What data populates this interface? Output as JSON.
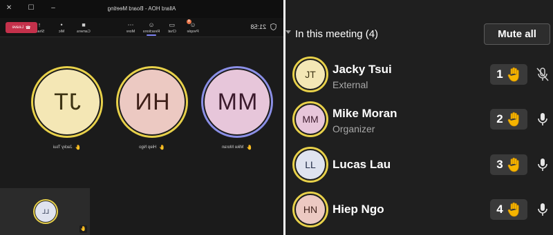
{
  "window": {
    "title": "Allard HOA - Board Meeting",
    "controls": [
      "✕",
      "☐",
      "–"
    ]
  },
  "toolbar": {
    "timer": "21:58",
    "items": [
      {
        "name": "people",
        "label": "People",
        "icon": "☺",
        "badge": "4"
      },
      {
        "name": "chat",
        "label": "Chat",
        "icon": "▭"
      },
      {
        "name": "reactions",
        "label": "Reactions",
        "icon": "☺"
      },
      {
        "name": "more",
        "label": "More",
        "icon": "⋯"
      }
    ],
    "controls": [
      {
        "name": "camera",
        "label": "Camera",
        "icon": "■"
      },
      {
        "name": "mic",
        "label": "Mic",
        "icon": "•"
      },
      {
        "name": "share",
        "label": "Share",
        "icon": "↑"
      }
    ],
    "leave_label": "Leave"
  },
  "stage": {
    "tiles": [
      {
        "initials": "MM",
        "name": "Mike Moran",
        "bg": "#e7c6da",
        "fg": "#3b1a2c",
        "ring": "#8b8fe6"
      },
      {
        "initials": "HN",
        "name": "Hiep Ngo",
        "bg": "#ecc9c2",
        "fg": "#3d1f18",
        "ring": "#e8d14a"
      },
      {
        "initials": "JT",
        "name": "Jacky Tsui",
        "bg": "#f4e7b5",
        "fg": "#3d3313",
        "ring": "#e8d14a"
      }
    ],
    "self_view": {
      "initials": "LL",
      "bg": "#dfe3ef",
      "fg": "#1f2a44"
    }
  },
  "panel": {
    "title": "In this meeting (4)",
    "mute_all_label": "Mute all",
    "participants": [
      {
        "initials": "JT",
        "name": "Jacky Tsui",
        "role": "External",
        "hand_order": "1",
        "muted": true,
        "avatar_bg": "#f4e7b5",
        "avatar_fg": "#3d3313"
      },
      {
        "initials": "MM",
        "name": "Mike Moran",
        "role": "Organizer",
        "hand_order": "2",
        "muted": false,
        "avatar_bg": "#e7c6da",
        "avatar_fg": "#3b1a2c"
      },
      {
        "initials": "LL",
        "name": "Lucas Lau",
        "role": "",
        "hand_order": "3",
        "muted": false,
        "avatar_bg": "#dfe3ef",
        "avatar_fg": "#1f2a44"
      },
      {
        "initials": "HN",
        "name": "Hiep Ngo",
        "role": "",
        "hand_order": "4",
        "muted": false,
        "avatar_bg": "#ecc9c2",
        "avatar_fg": "#3d1f18"
      }
    ]
  },
  "colors": {
    "raised_hand": "#f5b400",
    "speaking_ring": "#e8d14a",
    "leave_red": "#c4314b",
    "accent": "#7f85f5"
  }
}
